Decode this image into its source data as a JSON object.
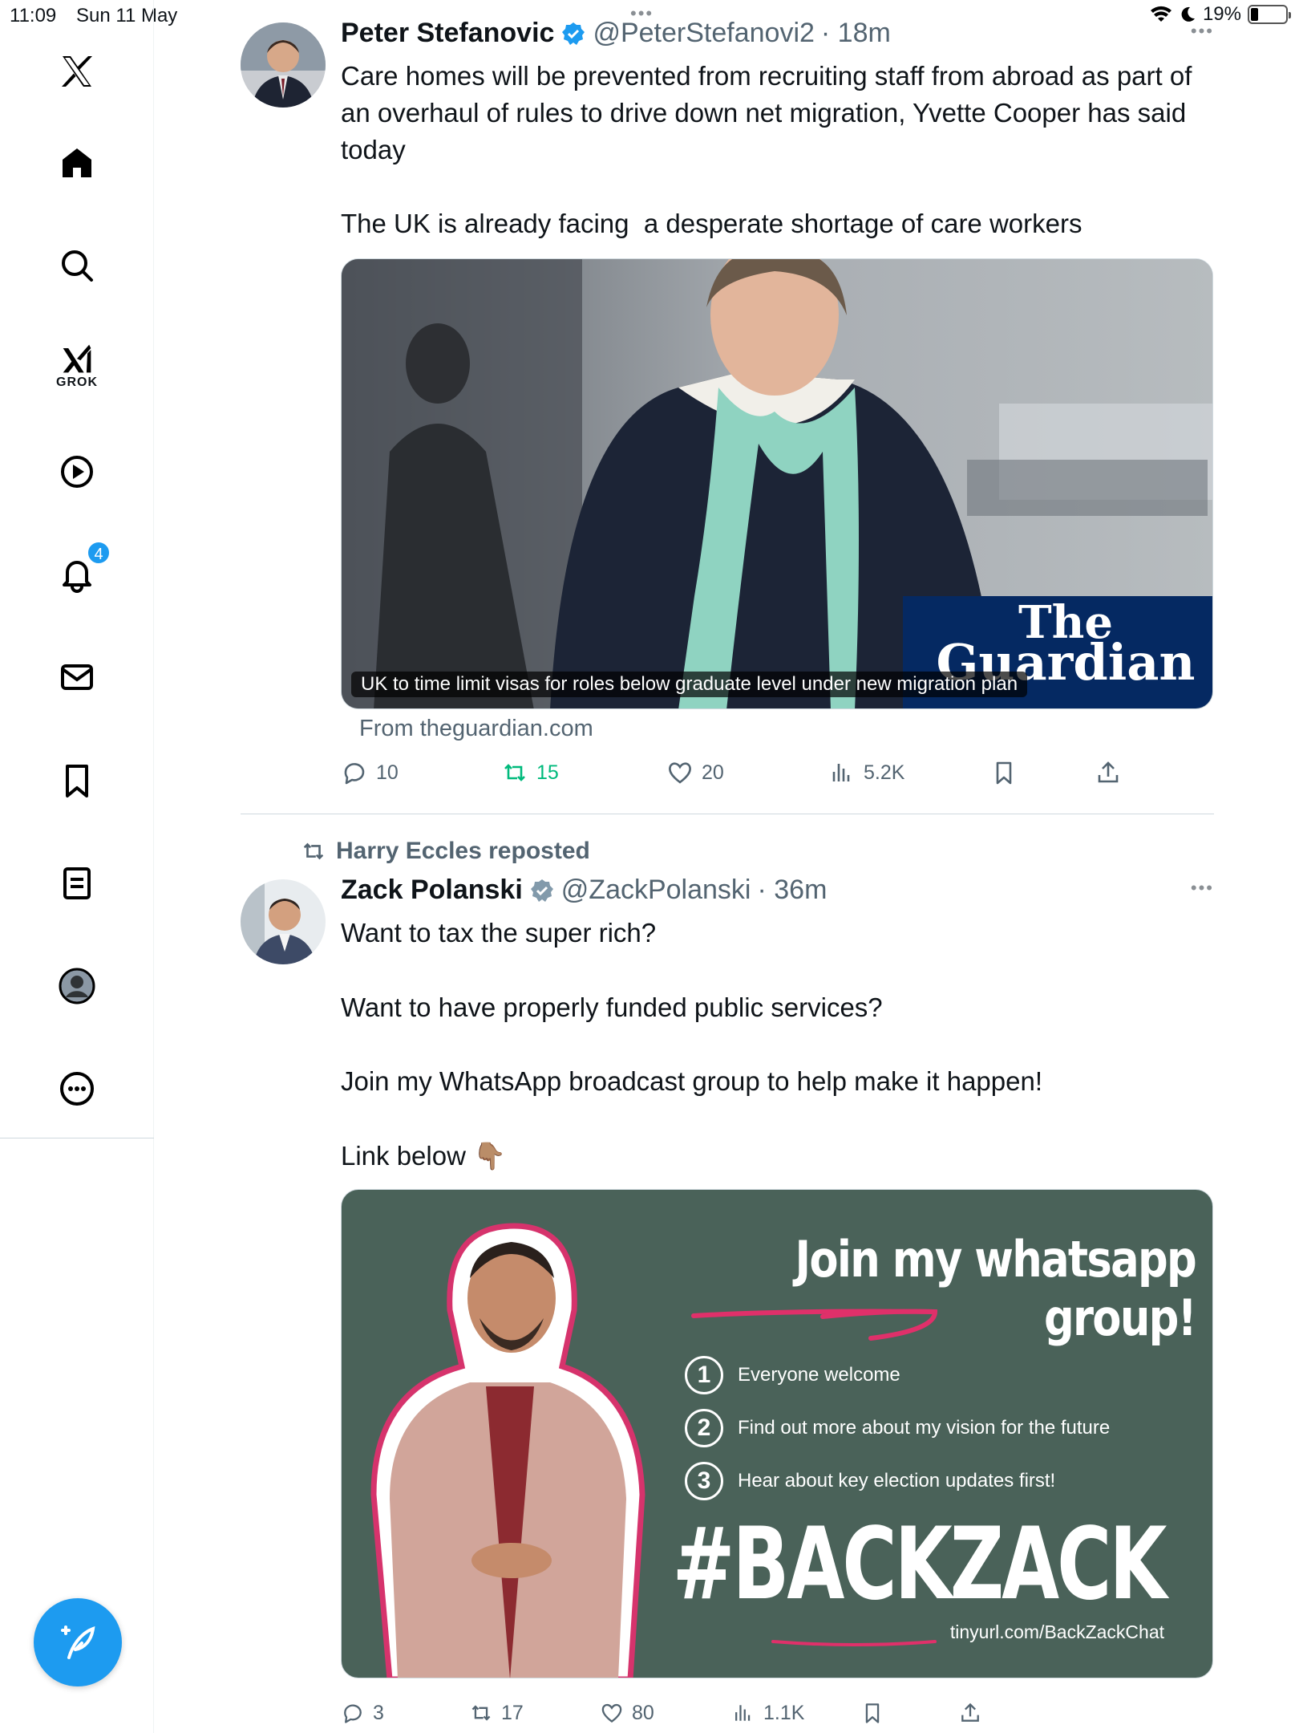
{
  "status": {
    "time": "11:09",
    "date": "Sun 11 May",
    "battery": "19%",
    "battery_level": 0.19
  },
  "sidebar": {
    "items": [
      {
        "name": "x-logo-icon"
      },
      {
        "name": "home-icon"
      },
      {
        "name": "search-icon"
      },
      {
        "name": "grok-icon",
        "label": "GROK"
      },
      {
        "name": "video-icon"
      },
      {
        "name": "notifications-icon",
        "badge": "4"
      },
      {
        "name": "messages-icon"
      },
      {
        "name": "bookmarks-icon"
      },
      {
        "name": "lists-icon"
      },
      {
        "name": "profile-icon"
      },
      {
        "name": "more-icon"
      }
    ],
    "compose_icon": "compose-icon"
  },
  "tweets": [
    {
      "author": "Peter Stefanovic",
      "handle": "@PeterStefanovi2",
      "time": "· 18m",
      "text": "Care homes will be prevented from recruiting staff from abroad as part of an overhaul of rules to drive down net migration, Yvette Cooper has said today\n\nThe UK is already facing  a desperate shortage of care workers",
      "card": {
        "caption": "UK to time limit visas for roles below graduate level under new migration plan",
        "source": "From theguardian.com",
        "logo_line1": "The",
        "logo_line2": "Guardian"
      },
      "stats": {
        "replies": "10",
        "reposts": "15",
        "likes": "20",
        "views": "5.2K"
      }
    },
    {
      "reposted_by": "Harry Eccles reposted",
      "author": "Zack Polanski",
      "handle": "@ZackPolanski",
      "time": "· 36m",
      "text": "Want to tax the super rich?\n\nWant to have properly funded public services?\n\nJoin my WhatsApp broadcast group to help make it happen!\n\nLink below",
      "emoji": "👇🏽",
      "image": {
        "headline": "Join my whatsapp group!",
        "points": [
          {
            "num": "1",
            "text": "Everyone welcome"
          },
          {
            "num": "2",
            "text": "Find out more about my vision for the future"
          },
          {
            "num": "3",
            "text": "Hear about key election updates first!"
          }
        ],
        "hashtag": "#BACKZACK",
        "url": "tinyurl.com/BackZackChat"
      },
      "stats": {
        "replies": "3",
        "reposts": "17",
        "likes": "80",
        "views": "1.1K"
      }
    }
  ],
  "colors": {
    "accent": "#1d9bf0",
    "repost_green": "#00ba7c",
    "card_bg": "#4a6259",
    "pink": "#e0306a",
    "guardian_blue": "#052962"
  }
}
